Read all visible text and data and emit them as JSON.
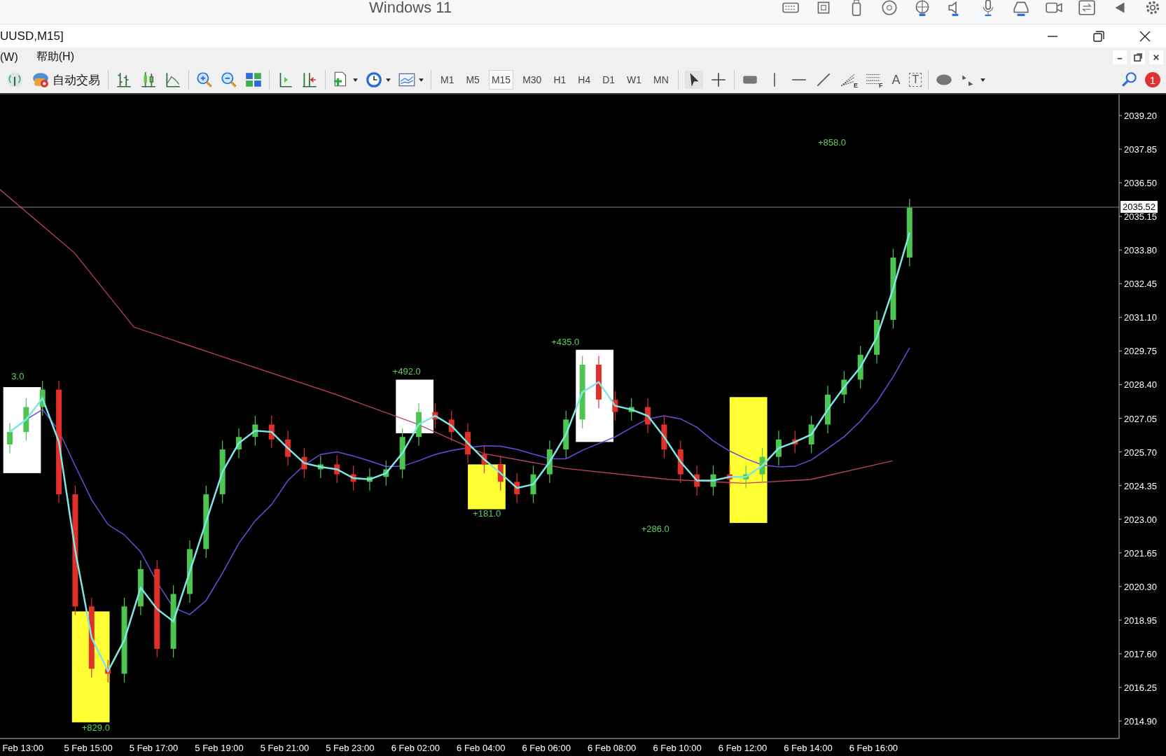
{
  "taskbar": {
    "title": "Windows 11"
  },
  "window": {
    "title": "UUSD,M15]"
  },
  "menu": [
    {
      "label": "(W)"
    },
    {
      "label": "帮助(H)"
    }
  ],
  "toolbar": {
    "auto_trading": "自动交易",
    "timeframes": [
      {
        "label": "M1",
        "selected": false
      },
      {
        "label": "M5",
        "selected": false
      },
      {
        "label": "M15",
        "selected": true
      },
      {
        "label": "M30",
        "selected": false
      },
      {
        "label": "H1",
        "selected": false
      },
      {
        "label": "H4",
        "selected": false
      },
      {
        "label": "D1",
        "selected": false
      },
      {
        "label": "W1",
        "selected": false
      },
      {
        "label": "MN",
        "selected": false
      }
    ],
    "drawing_tools": [
      {
        "kind": "fan",
        "mark": "E"
      },
      {
        "kind": "levels",
        "mark": "F"
      },
      {
        "kind": "text",
        "mark": "A"
      },
      {
        "kind": "label",
        "mark": "T"
      }
    ],
    "notifications": "1"
  },
  "chart": {
    "current_price": "2035.52",
    "price_labels": [
      "2039.20",
      "2037.85",
      "2036.50",
      "2035.15",
      "2033.80",
      "2032.45",
      "2031.10",
      "2029.75",
      "2028.40",
      "2027.05",
      "2025.70",
      "2024.35",
      "2023.00",
      "2021.65",
      "2020.30",
      "2018.95",
      "2017.60",
      "2016.25",
      "2014.90"
    ],
    "time_labels": [
      "Feb 13:00",
      "5 Feb 15:00",
      "5 Feb 17:00",
      "5 Feb 19:00",
      "5 Feb 21:00",
      "5 Feb 23:00",
      "6 Feb 02:00",
      "6 Feb 04:00",
      "6 Feb 06:00",
      "6 Feb 08:00",
      "6 Feb 10:00",
      "6 Feb 12:00",
      "6 Feb 14:00",
      "6 Feb 16:00"
    ],
    "trade_labels": [
      "3.0",
      "+829.0",
      "+492.0",
      "+181.0",
      "+435.0",
      "+286.0",
      "+858.0"
    ]
  }
}
